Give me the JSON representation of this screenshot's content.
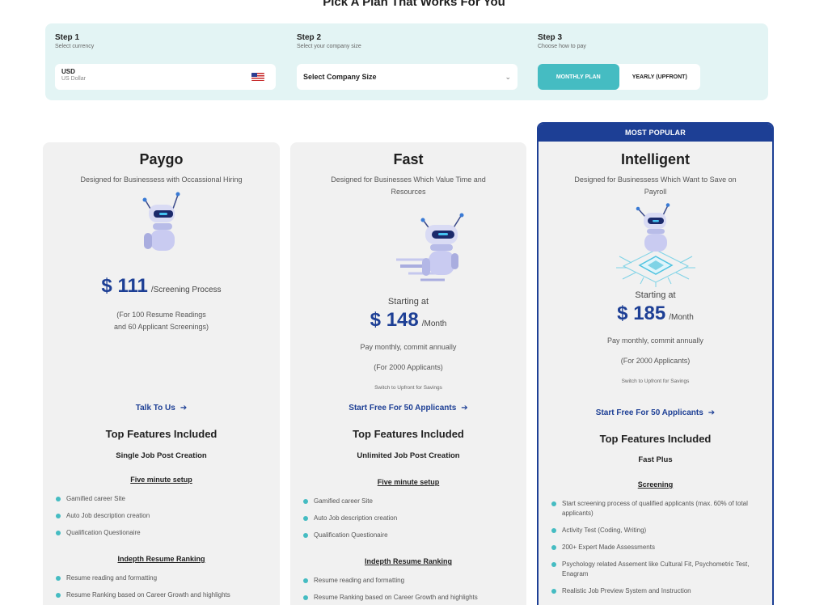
{
  "page_title": "Pick A Plan That Works For You",
  "steps": {
    "step1": {
      "title": "Step 1",
      "subtitle": "Select currency",
      "currency_code": "USD",
      "currency_name": "US Dollar"
    },
    "step2": {
      "title": "Step 2",
      "subtitle": "Select your company size",
      "select_value": "Select Company Size"
    },
    "step3": {
      "title": "Step 3",
      "subtitle": "Choose how to pay",
      "monthly_label": "MONTHLY PLAN",
      "yearly_label": "YEARLY (UPFRONT)",
      "selected": "monthly"
    }
  },
  "colors": {
    "accent_teal": "#45bcc2",
    "brand_blue": "#1d3f95",
    "panel_bg": "#e3f4f4",
    "card_bg": "#f1f1f1"
  },
  "plans": [
    {
      "name": "Paygo",
      "description": "Designed for Businessess with Occassional Hiring",
      "price": "$ 111",
      "price_unit": "/Screening Process",
      "note_line1": "(For 100 Resume Readings",
      "note_line2": "and 60 Applicant Screenings)",
      "cta": "Talk To Us",
      "features_title": "Top Features Included",
      "features_subtitle": "Single Job Post Creation",
      "group1_title": "Five minute setup",
      "group1_items": [
        "Gamified career Site",
        "Auto Job description creation",
        "Qualification Questionaire"
      ],
      "group2_title": "Indepth Resume Ranking",
      "group2_items": [
        "Resume reading and formatting",
        "Resume Ranking based on Career Growth and highlights"
      ]
    },
    {
      "name": "Fast",
      "description": "Designed for Businesses Which Value Time and Resources",
      "starting": "Starting at",
      "price": "$ 148",
      "price_unit": "/Month",
      "commit": "Pay monthly, commit annually",
      "applicants": "(For 2000 Applicants)",
      "switch": "Switch to Upfront for Savings",
      "cta": "Start Free For 50 Applicants",
      "features_title": "Top Features Included",
      "features_subtitle": "Unlimited Job Post Creation",
      "group1_title": "Five minute setup",
      "group1_items": [
        "Gamified career Site",
        "Auto Job description creation",
        "Qualification Questionaire"
      ],
      "group2_title": "Indepth Resume Ranking",
      "group2_items": [
        "Resume reading and formatting",
        "Resume Ranking based on Career Growth and highlights"
      ]
    },
    {
      "badge": "MOST POPULAR",
      "name": "Intelligent",
      "description": "Designed for Businessess Which Want to Save on Payroll",
      "starting": "Starting at",
      "price": "$ 185",
      "price_unit": "/Month",
      "commit": "Pay monthly, commit annually",
      "applicants": "(For 2000 Applicants)",
      "switch": "Switch to Upfront for Savings",
      "cta": "Start Free For 50 Applicants",
      "features_title": "Top Features Included",
      "features_subtitle": "Fast Plus",
      "group1_title": "Screening",
      "group1_items": [
        "Start screening process of qualified applicants (max. 60% of total applicants)",
        "Activity Test (Coding, Writing)",
        "200+ Expert Made Assessments",
        "Psychology related Assement like Cultural Fit, Psychometric Test, Enagram",
        "Realistic Job Preview System and Instruction"
      ]
    }
  ]
}
